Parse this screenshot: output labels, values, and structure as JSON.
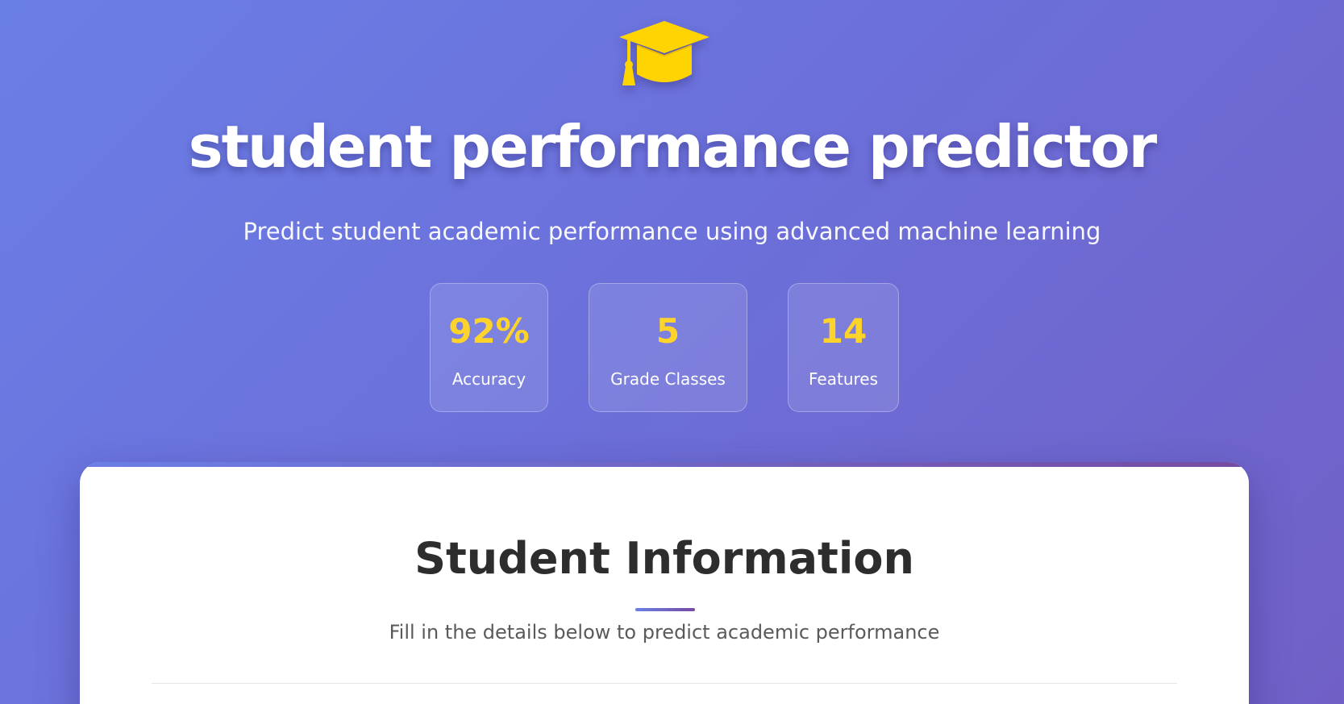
{
  "hero": {
    "icon": "graduation-cap-icon",
    "title": "student performance predictor",
    "subtitle": "Predict student academic performance using advanced machine learning"
  },
  "stats": [
    {
      "value": "92%",
      "label": "Accuracy"
    },
    {
      "value": "5",
      "label": "Grade Classes"
    },
    {
      "value": "14",
      "label": "Features"
    }
  ],
  "card": {
    "title": "Student Information",
    "subtitle": "Fill in the details below to predict academic performance"
  },
  "colors": {
    "accent_gold": "#ffd42a",
    "gradient_start": "#6a7fe6",
    "gradient_end": "#764ba2"
  }
}
